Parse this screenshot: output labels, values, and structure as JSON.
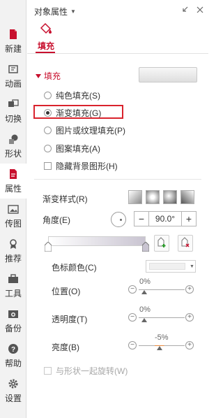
{
  "sidebar": {
    "items": [
      {
        "label": "新建",
        "icon": "new-file-icon"
      },
      {
        "label": "动画",
        "icon": "animation-icon"
      },
      {
        "label": "切换",
        "icon": "transition-icon"
      },
      {
        "label": "形状",
        "icon": "shape-icon"
      },
      {
        "label": "属性",
        "icon": "properties-icon",
        "active": true
      },
      {
        "label": "传图",
        "icon": "upload-image-icon"
      },
      {
        "label": "推荐",
        "icon": "recommend-icon"
      },
      {
        "label": "工具",
        "icon": "toolbox-icon"
      },
      {
        "label": "备份",
        "icon": "backup-icon"
      },
      {
        "label": "帮助",
        "icon": "help-icon"
      },
      {
        "label": "设置",
        "icon": "gear-icon"
      }
    ]
  },
  "panel": {
    "title": "对象属性",
    "tab_label": "填充",
    "section_label": "填充",
    "options": {
      "solid": "纯色填充(S)",
      "gradient": "渐变填充(G)",
      "picture": "图片或纹理填充(P)",
      "pattern": "图案填充(A)",
      "hide_bg": "隐藏背景图形(H)"
    },
    "selected_option": "gradient",
    "gradient_style_label": "渐变样式(R)",
    "angle_label": "角度(E)",
    "angle_value": "90.0°",
    "stop_color_label": "色标颜色(C)",
    "position_label": "位置(O)",
    "position_value": "0%",
    "transparency_label": "透明度(T)",
    "transparency_value": "0%",
    "brightness_label": "亮度(B)",
    "brightness_value": "-5%",
    "rotate_label": "与形状一起旋转(W)",
    "minus": "−",
    "plus": "+",
    "accent_color": "#c8102e"
  }
}
